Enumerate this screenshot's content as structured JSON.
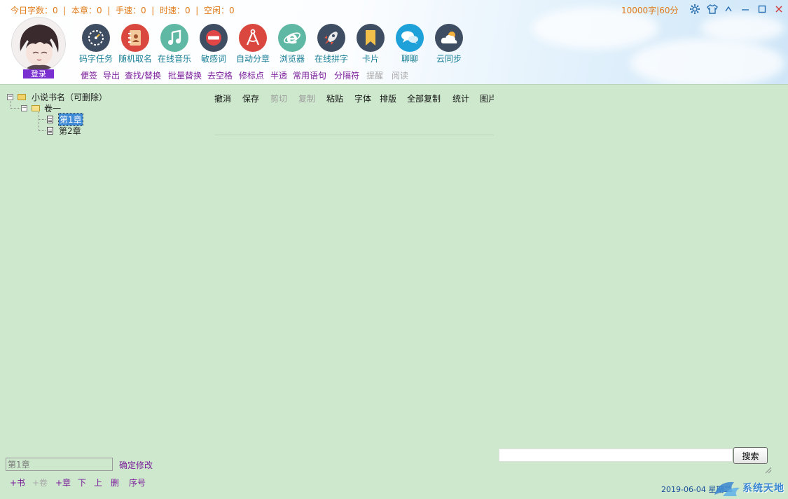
{
  "stats": {
    "today": "今日字数：0",
    "chapter": "本章：0",
    "speed": "手速：0",
    "time": "时速：0",
    "idle": "空闲：0",
    "sep": "|"
  },
  "goal": "10000字|60分",
  "login_label": "登录",
  "tools": [
    {
      "label": "码字任务",
      "icon": "speedometer-icon",
      "color": "#3f4d63"
    },
    {
      "label": "随机取名",
      "icon": "contact-book-icon",
      "color": "#d9473f"
    },
    {
      "label": "在线音乐",
      "icon": "music-note-icon",
      "color": "#5fb8a3"
    },
    {
      "label": "敏感词",
      "icon": "no-entry-icon",
      "color": "#3f4d63"
    },
    {
      "label": "自动分章",
      "icon": "compass-icon",
      "color": "#d9473f"
    },
    {
      "label": "浏览器",
      "icon": "browser-e-icon",
      "color": "#5fb8a3"
    },
    {
      "label": "在线拼字",
      "icon": "rocket-icon",
      "color": "#3f4d63"
    },
    {
      "label": "卡片",
      "icon": "bookmark-icon",
      "color": "#3f4d63"
    },
    {
      "label": "聊聊",
      "icon": "chat-bubbles-icon",
      "color": "#1ea0d8"
    },
    {
      "label": "云同步",
      "icon": "cloud-sun-icon",
      "color": "#3f4d63"
    }
  ],
  "sublinks": [
    "便签",
    "导出",
    "查找/替换",
    "批量替换",
    "去空格",
    "修标点",
    "半透",
    "常用语句",
    "分隔符",
    "提醒",
    "阅读"
  ],
  "tree": {
    "book": "小说书名（可删除）",
    "volume": "卷一",
    "chapters": [
      "第1章",
      "第2章"
    ]
  },
  "editor_toolbar": [
    "撤消",
    "保存",
    "剪切",
    "复制",
    "粘贴",
    "字体",
    "排版",
    "全部复制",
    "统计",
    "图片"
  ],
  "chapter_input_value": "第1章",
  "confirm_label": "确定修改",
  "bottom_links": [
    "+书",
    "+卷",
    "+章",
    "下",
    "上",
    "删",
    "序号"
  ],
  "search_button": "搜索",
  "date_text": "2019-06-04 星期二",
  "watermark": "系统天地",
  "colors": {
    "background": "#cde8cd",
    "stats_orange": "#e07b1a",
    "tool_label_teal": "#1a7f95",
    "link_purple": "#7a1c9a",
    "login_purple": "#7a2fd0"
  }
}
